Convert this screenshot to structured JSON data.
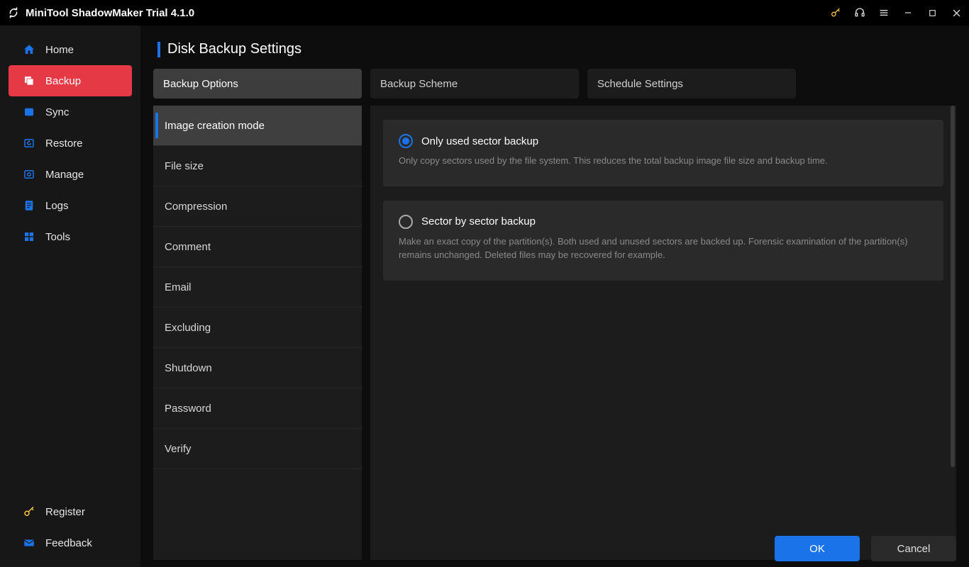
{
  "app": {
    "title": "MiniTool ShadowMaker Trial 4.1.0"
  },
  "titlebar_icons": {
    "key": "key-icon",
    "headset": "headset-icon",
    "menu": "menu-icon",
    "minimize": "minimize-icon",
    "maximize": "maximize-icon",
    "close": "close-icon"
  },
  "sidebar": {
    "items": [
      {
        "label": "Home",
        "icon": "home-icon",
        "active": false
      },
      {
        "label": "Backup",
        "icon": "backup-icon",
        "active": true
      },
      {
        "label": "Sync",
        "icon": "sync-icon",
        "active": false
      },
      {
        "label": "Restore",
        "icon": "restore-icon",
        "active": false
      },
      {
        "label": "Manage",
        "icon": "manage-icon",
        "active": false
      },
      {
        "label": "Logs",
        "icon": "logs-icon",
        "active": false
      },
      {
        "label": "Tools",
        "icon": "tools-icon",
        "active": false
      }
    ],
    "bottom": [
      {
        "label": "Register",
        "icon": "key-icon"
      },
      {
        "label": "Feedback",
        "icon": "mail-icon"
      }
    ]
  },
  "page": {
    "title": "Disk Backup Settings"
  },
  "tabs": [
    {
      "label": "Backup Options",
      "active": true
    },
    {
      "label": "Backup Scheme",
      "active": false
    },
    {
      "label": "Schedule Settings",
      "active": false
    }
  ],
  "settings_list": [
    {
      "label": "Image creation mode",
      "active": true
    },
    {
      "label": "File size",
      "active": false
    },
    {
      "label": "Compression",
      "active": false
    },
    {
      "label": "Comment",
      "active": false
    },
    {
      "label": "Email",
      "active": false
    },
    {
      "label": "Excluding",
      "active": false
    },
    {
      "label": "Shutdown",
      "active": false
    },
    {
      "label": "Password",
      "active": false
    },
    {
      "label": "Verify",
      "active": false
    }
  ],
  "options": [
    {
      "title": "Only used sector backup",
      "desc": "Only copy sectors used by the file system. This reduces the total backup image file size and backup time.",
      "selected": true
    },
    {
      "title": "Sector by sector backup",
      "desc": "Make an exact copy of the partition(s). Both used and unused sectors are backed up. Forensic examination of the partition(s) remains unchanged. Deleted files may be recovered for example.",
      "selected": false
    }
  ],
  "buttons": {
    "ok": "OK",
    "cancel": "Cancel"
  }
}
